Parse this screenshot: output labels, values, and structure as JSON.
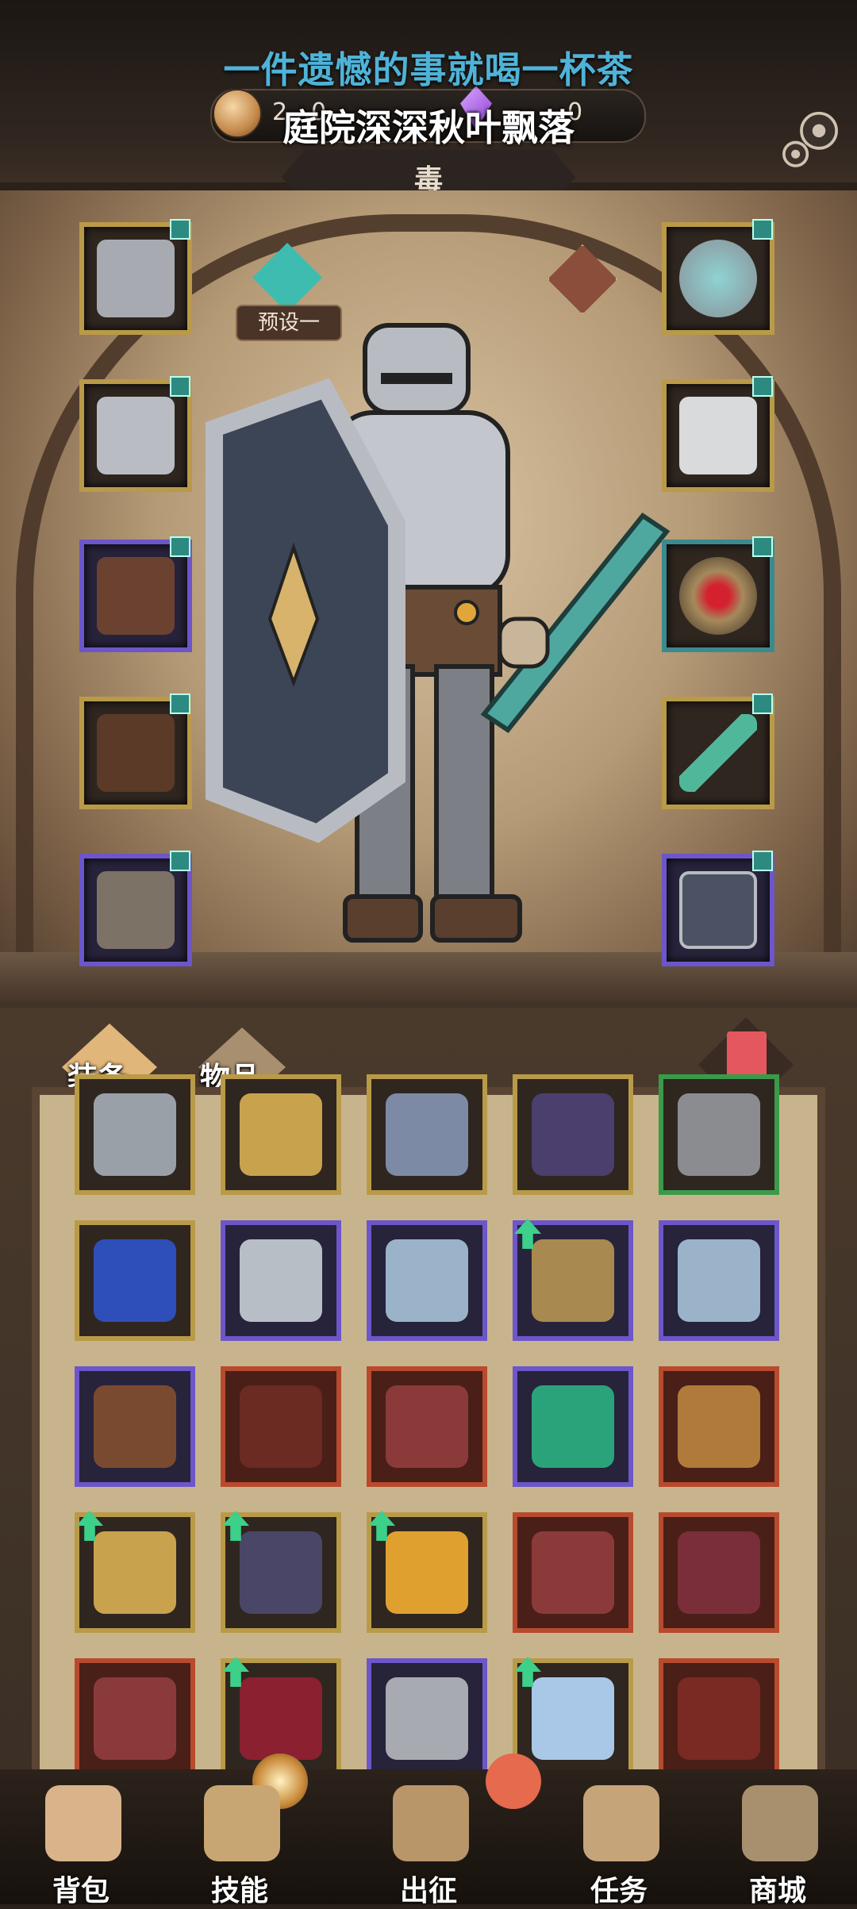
{
  "overlay": {
    "line1": "一件遗憾的事就喝一杯茶",
    "line2": "庭院深深秋叶飘落"
  },
  "currency": {
    "coin_value": "2…0",
    "gem_value": "0"
  },
  "title": "毒",
  "preset": {
    "label": "预设一"
  },
  "colors": {
    "overlay_text": "#4fb3d8",
    "gold_frame": "#b99a48",
    "epic_frame": "#6c56c9",
    "legend_frame": "#b84a2e",
    "upgrade_arrow": "#3cd08a"
  },
  "equipment_slots": [
    {
      "name": "helmet-slot",
      "icon": "knight-helmet-icon",
      "side": "left"
    },
    {
      "name": "chest-slot",
      "icon": "plate-armor-icon",
      "side": "left"
    },
    {
      "name": "gloves-slot",
      "icon": "leather-gloves-icon",
      "side": "left"
    },
    {
      "name": "belt-slot",
      "icon": "tattered-belt-icon",
      "side": "left"
    },
    {
      "name": "boots-slot",
      "icon": "iron-boots-icon",
      "side": "left"
    },
    {
      "name": "amulet-slot",
      "icon": "silver-amulet-icon",
      "side": "right"
    },
    {
      "name": "cape-slot",
      "icon": "feather-cape-icon",
      "side": "right"
    },
    {
      "name": "ring-slot",
      "icon": "red-gem-ring-icon",
      "side": "right"
    },
    {
      "name": "weapon-slot",
      "icon": "green-greatsword-icon",
      "side": "right"
    },
    {
      "name": "offhand-slot",
      "icon": "iron-shield-icon",
      "side": "right"
    }
  ],
  "bag": {
    "tab_equipment": "装备",
    "tab_items": "物品",
    "items": [
      {
        "icon": "sword-icon",
        "frame": "gold"
      },
      {
        "icon": "holy-shield-amulet-icon",
        "frame": "gold"
      },
      {
        "icon": "serpent-amulet-icon",
        "frame": "gold"
      },
      {
        "icon": "dark-helmet-icon",
        "frame": "gold"
      },
      {
        "icon": "cloak-icon",
        "frame": "green"
      },
      {
        "icon": "blue-heart-amulet-icon",
        "frame": "gold"
      },
      {
        "icon": "steel-sword-icon",
        "frame": "purple"
      },
      {
        "icon": "lantern-amulet-icon",
        "frame": "purple"
      },
      {
        "icon": "brass-helmet-icon",
        "frame": "purple",
        "upgrade": true
      },
      {
        "icon": "lantern-amulet-icon",
        "frame": "purple"
      },
      {
        "icon": "leather-cap-icon",
        "frame": "purple"
      },
      {
        "icon": "crimson-robe-icon",
        "frame": "red"
      },
      {
        "icon": "crimson-gauntlets-icon",
        "frame": "red"
      },
      {
        "icon": "emerald-amulet-icon",
        "frame": "purple"
      },
      {
        "icon": "bronze-dagger-icon",
        "frame": "red"
      },
      {
        "icon": "golden-spear-icon",
        "frame": "gold",
        "upgrade": true
      },
      {
        "icon": "dark-armor-icon",
        "frame": "gold",
        "upgrade": true
      },
      {
        "icon": "flame-mace-icon",
        "frame": "gold",
        "upgrade": true
      },
      {
        "icon": "crimson-gauntlets-icon",
        "frame": "red"
      },
      {
        "icon": "crimson-boots-icon",
        "frame": "red"
      },
      {
        "icon": "crimson-gauntlets-icon",
        "frame": "red"
      },
      {
        "icon": "crimson-scythe-icon",
        "frame": "gold",
        "upgrade": true
      },
      {
        "icon": "plumed-helmet-icon",
        "frame": "purple"
      },
      {
        "icon": "ice-spear-icon",
        "frame": "gold",
        "upgrade": true
      },
      {
        "icon": "crimson-skirt-icon",
        "frame": "red"
      }
    ]
  },
  "nav": [
    {
      "label": "背包",
      "icon": "backpack-icon"
    },
    {
      "label": "技能",
      "icon": "skill-book-icon"
    },
    {
      "label": "出征",
      "icon": "map-icon"
    },
    {
      "label": "任务",
      "icon": "scroll-icon"
    },
    {
      "label": "商城",
      "icon": "shop-crown-icon"
    }
  ]
}
